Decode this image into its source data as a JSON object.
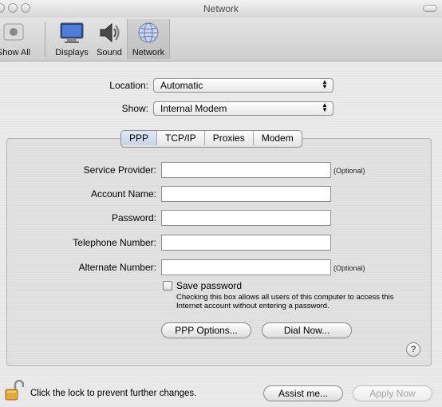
{
  "window": {
    "title": "Network"
  },
  "toolbar": {
    "items": [
      {
        "label": "Show All",
        "icon": "apple-grid-icon"
      },
      {
        "label": "Displays",
        "icon": "display-icon"
      },
      {
        "label": "Sound",
        "icon": "speaker-icon"
      },
      {
        "label": "Network",
        "icon": "globe-icon"
      }
    ]
  },
  "location": {
    "label": "Location:",
    "value": "Automatic"
  },
  "show": {
    "label": "Show:",
    "value": "Internal Modem"
  },
  "tabs": [
    {
      "label": "PPP",
      "selected": true
    },
    {
      "label": "TCP/IP",
      "selected": false
    },
    {
      "label": "Proxies",
      "selected": false
    },
    {
      "label": "Modem",
      "selected": false
    }
  ],
  "fields": [
    {
      "label": "Service Provider:",
      "value": "",
      "note": "(Optional)"
    },
    {
      "label": "Account Name:",
      "value": "",
      "note": ""
    },
    {
      "label": "Password:",
      "value": "",
      "note": ""
    },
    {
      "label": "Telephone Number:",
      "value": "",
      "note": ""
    },
    {
      "label": "Alternate Number:",
      "value": "",
      "note": "(Optional)"
    }
  ],
  "save_password": {
    "label": "Save password",
    "checked": false,
    "note": "Checking this box allows all users of this computer to access this Internet account without entering a password."
  },
  "buttons": {
    "ppp_options": "PPP Options...",
    "dial_now": "Dial Now...",
    "help": "?",
    "assist": "Assist me...",
    "apply": "Apply Now"
  },
  "lock": {
    "text": "Click the lock to prevent further changes."
  }
}
